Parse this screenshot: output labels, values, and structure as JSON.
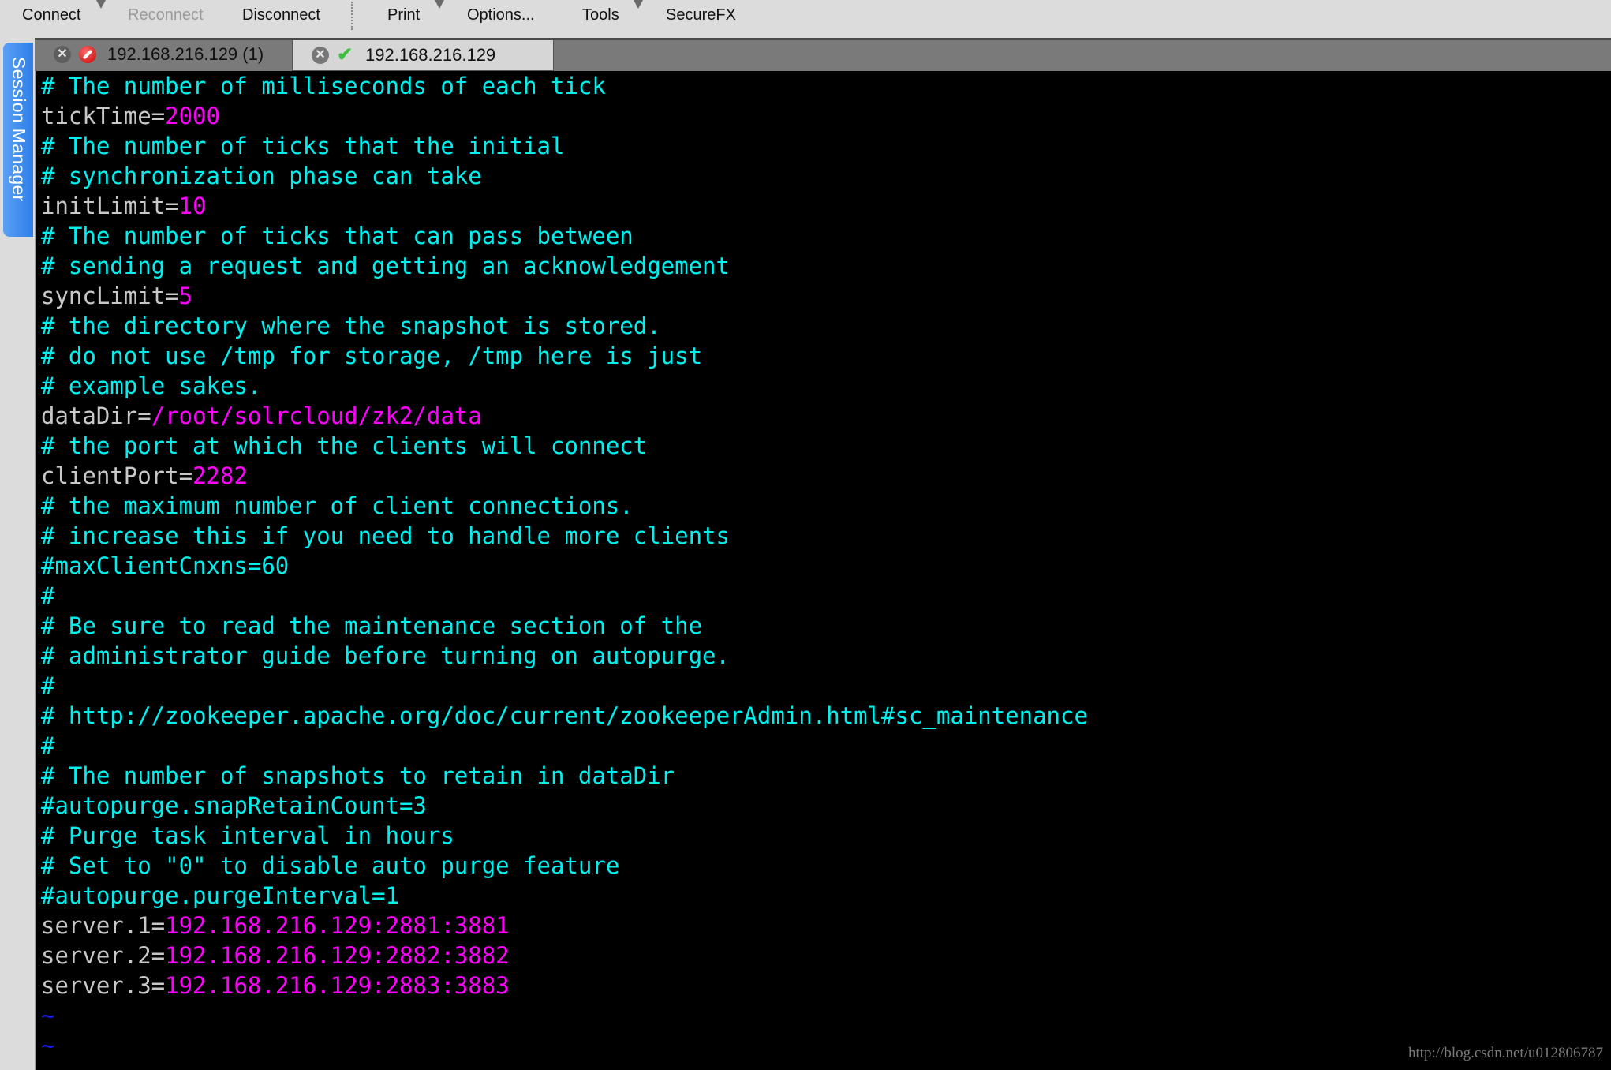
{
  "toolbar": {
    "items": [
      {
        "label": "Connect",
        "enabled": true,
        "has_dropdown": true
      },
      {
        "label": "Reconnect",
        "enabled": false,
        "has_dropdown": false
      },
      {
        "label": "Disconnect",
        "enabled": true,
        "has_dropdown": false
      },
      {
        "label": "Print",
        "enabled": true,
        "has_dropdown": true
      },
      {
        "label": "Options...",
        "enabled": true,
        "has_dropdown": false
      },
      {
        "label": "Tools",
        "enabled": true,
        "has_dropdown": true
      },
      {
        "label": "SecureFX",
        "enabled": true,
        "has_dropdown": false
      }
    ]
  },
  "sidebar": {
    "session_manager_label": "Session Manager"
  },
  "tabs": [
    {
      "label": "192.168.216.129 (1)",
      "status": "disconnected",
      "active": false,
      "close_icon": "close-icon",
      "status_icon": "error-icon"
    },
    {
      "label": "192.168.216.129",
      "status": "connected",
      "active": true,
      "close_icon": "close-icon",
      "status_icon": "check-icon"
    }
  ],
  "terminal": {
    "colors": {
      "comment": "#00f0f0",
      "key": "#c8c8c8",
      "value": "#ff00ff",
      "tilde": "#1a1aff",
      "background": "#000000"
    },
    "lines": [
      {
        "type": "comment",
        "text": "# The number of milliseconds of each tick"
      },
      {
        "type": "kv",
        "key": "tickTime=",
        "value": "2000"
      },
      {
        "type": "comment",
        "text": "# The number of ticks that the initial"
      },
      {
        "type": "comment",
        "text": "# synchronization phase can take"
      },
      {
        "type": "kv",
        "key": "initLimit=",
        "value": "10"
      },
      {
        "type": "comment",
        "text": "# The number of ticks that can pass between"
      },
      {
        "type": "comment",
        "text": "# sending a request and getting an acknowledgement"
      },
      {
        "type": "kv",
        "key": "syncLimit=",
        "value": "5"
      },
      {
        "type": "comment",
        "text": "# the directory where the snapshot is stored."
      },
      {
        "type": "comment",
        "text": "# do not use /tmp for storage, /tmp here is just"
      },
      {
        "type": "comment",
        "text": "# example sakes."
      },
      {
        "type": "kv",
        "key": "dataDir=",
        "value": "/root/solrcloud/zk2/data"
      },
      {
        "type": "comment",
        "text": "# the port at which the clients will connect"
      },
      {
        "type": "kv",
        "key": "clientPort=",
        "value": "2282"
      },
      {
        "type": "comment",
        "text": "# the maximum number of client connections."
      },
      {
        "type": "comment",
        "text": "# increase this if you need to handle more clients"
      },
      {
        "type": "comment",
        "text": "#maxClientCnxns=60"
      },
      {
        "type": "comment",
        "text": "#"
      },
      {
        "type": "comment",
        "text": "# Be sure to read the maintenance section of the"
      },
      {
        "type": "comment",
        "text": "# administrator guide before turning on autopurge."
      },
      {
        "type": "comment",
        "text": "#"
      },
      {
        "type": "comment",
        "text": "# http://zookeeper.apache.org/doc/current/zookeeperAdmin.html#sc_maintenance"
      },
      {
        "type": "comment",
        "text": "#"
      },
      {
        "type": "comment",
        "text": "# The number of snapshots to retain in dataDir"
      },
      {
        "type": "comment",
        "text": "#autopurge.snapRetainCount=3"
      },
      {
        "type": "comment",
        "text": "# Purge task interval in hours"
      },
      {
        "type": "comment",
        "text": "# Set to \"0\" to disable auto purge feature"
      },
      {
        "type": "comment",
        "text": "#autopurge.purgeInterval=1"
      },
      {
        "type": "kv",
        "key": "server.1=",
        "value": "192.168.216.129:2881:3881"
      },
      {
        "type": "kv",
        "key": "server.2=",
        "value": "192.168.216.129:2882:3882"
      },
      {
        "type": "kv",
        "key": "server.3=",
        "value": "192.168.216.129:2883:3883"
      },
      {
        "type": "tilde",
        "text": "~"
      },
      {
        "type": "tilde",
        "text": "~"
      }
    ]
  },
  "watermark": "http://blog.csdn.net/u012806787"
}
